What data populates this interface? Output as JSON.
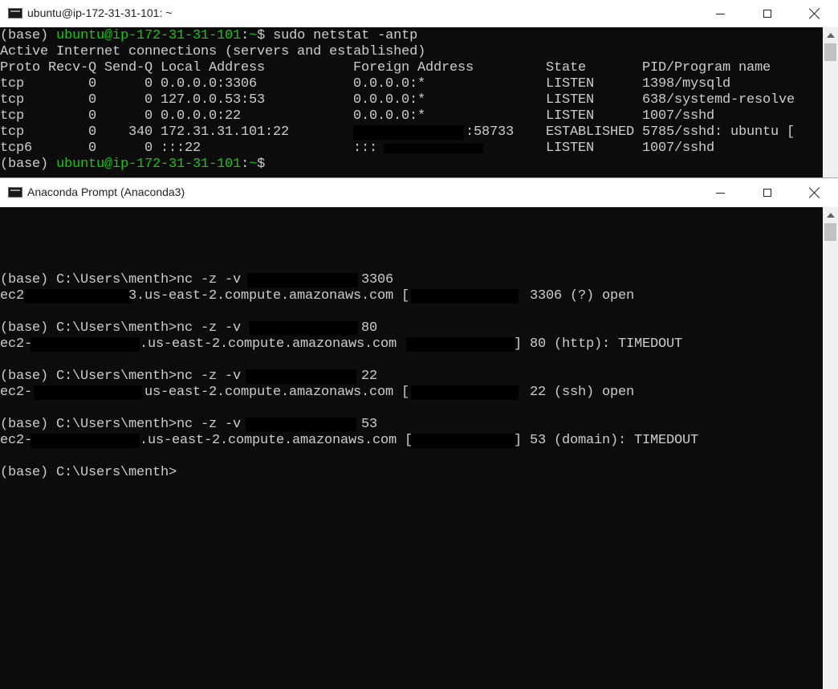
{
  "colors": {
    "prompt_green": "#16c60c",
    "text": "#cccccc",
    "bg": "#0c0c0c"
  },
  "ubuntu_window": {
    "title": "ubuntu@ip-172-31-31-101: ~",
    "icon": "terminal-icon",
    "line1": {
      "prefix": "(base) ",
      "userhost": "ubuntu@ip-172-31-31-101",
      "colon": ":",
      "path": "~",
      "cmd": "$ sudo netstat -antp"
    },
    "line2": "Active Internet connections (servers and established)",
    "header": {
      "proto": "Proto",
      "recvq": "Recv-Q",
      "sendq": "Send-Q",
      "local": "Local Address",
      "foreign": "Foreign Address",
      "state": "State",
      "pid": "PID/Program name"
    },
    "rows": [
      {
        "proto": "tcp",
        "recvq": "0",
        "sendq": "0",
        "local": "0.0.0.0:3306",
        "foreign": "0.0.0.0:*",
        "state": "LISTEN",
        "pid": "1398/mysqld"
      },
      {
        "proto": "tcp",
        "recvq": "0",
        "sendq": "0",
        "local": "127.0.0.53:53",
        "foreign": "0.0.0.0:*",
        "state": "LISTEN",
        "pid": "638/systemd-resolve"
      },
      {
        "proto": "tcp",
        "recvq": "0",
        "sendq": "0",
        "local": "0.0.0.0:22",
        "foreign": "0.0.0.0:*",
        "state": "LISTEN",
        "pid": "1007/sshd"
      },
      {
        "proto": "tcp",
        "recvq": "0",
        "sendq": "340",
        "local": "172.31.31.101:22",
        "foreign": ":58733",
        "state": "ESTABLISHED",
        "pid": "5785/sshd: ubuntu ["
      },
      {
        "proto": "tcp6",
        "recvq": "0",
        "sendq": "0",
        "local": ":::22",
        "foreign": ":::",
        "state": "LISTEN",
        "pid": "1007/sshd"
      }
    ],
    "last_prompt": {
      "prefix": "(base) ",
      "userhost": "ubuntu@ip-172-31-31-101",
      "colon": ":",
      "path": "~",
      "cmd": "$"
    }
  },
  "anaconda_window": {
    "title": "Anaconda Prompt (Anaconda3)",
    "icon": "terminal-icon",
    "prompt": "(base) C:\\Users\\menth>",
    "cmd_prefix": "nc -z -v ",
    "entries": [
      {
        "port": "3306",
        "host_prefix": "ec2",
        "host_suffix": "3.us-east-2.compute.amazonaws.com [",
        "result": " 3306 (?) open"
      },
      {
        "port": "80",
        "host_prefix": "ec2-",
        "host_suffix": ".us-east-2.compute.amazonaws.com",
        "result": "] 80 (http): TIMEDOUT"
      },
      {
        "port": "22",
        "host_prefix": "ec2-",
        "host_suffix": "us-east-2.compute.amazonaws.com [",
        "result": " 22 (ssh) open"
      },
      {
        "port": "53",
        "host_prefix": "ec2-",
        "host_suffix": ".us-east-2.compute.amazonaws.com [",
        "result": "] 53 (domain): TIMEDOUT"
      }
    ],
    "final_prompt": "(base) C:\\Users\\menth>"
  }
}
